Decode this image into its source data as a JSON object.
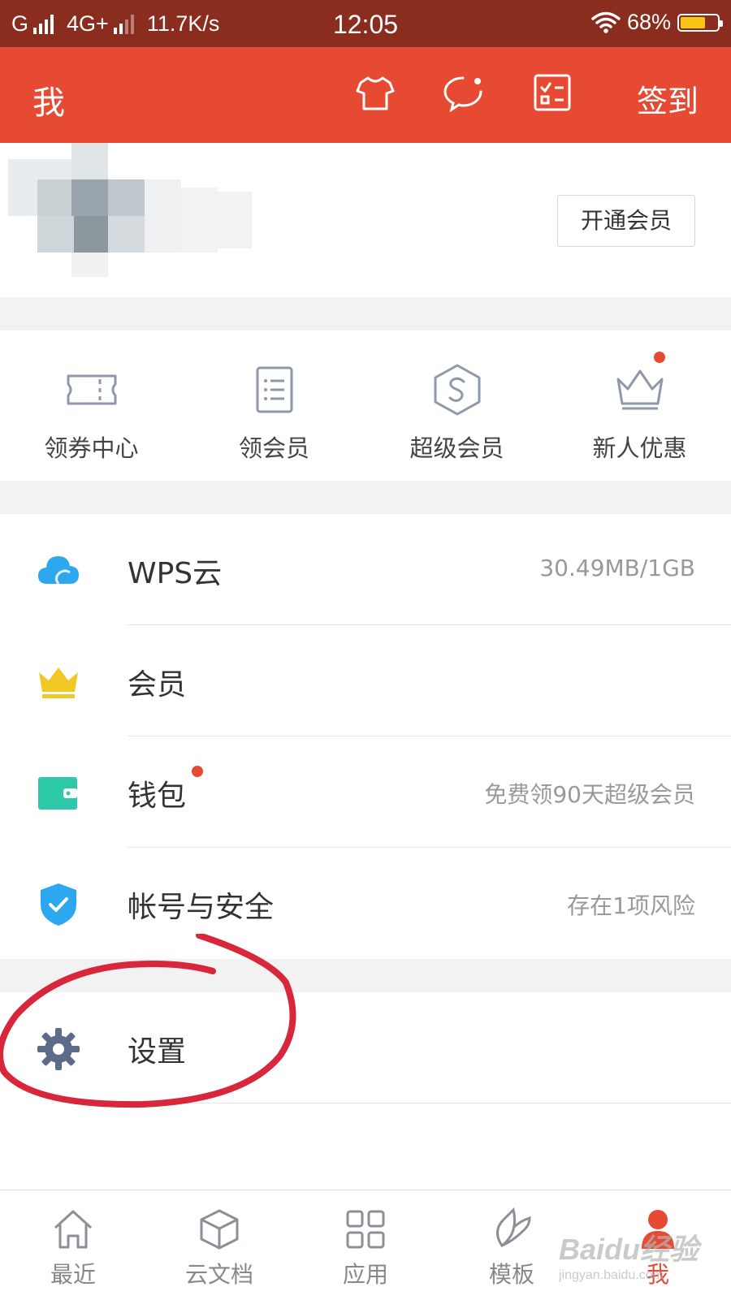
{
  "status_bar": {
    "carrier1": "G",
    "network": "4G+",
    "speed": "11.7K/s",
    "time": "12:05",
    "battery": "68%",
    "battery_level": 0.68
  },
  "header": {
    "title": "我",
    "icons": [
      "tshirt-icon",
      "chat-icon",
      "checklist-icon"
    ],
    "checkin_label": "签到"
  },
  "profile": {
    "member_button": "开通会员"
  },
  "quick_actions": [
    {
      "icon": "ticket-icon",
      "label": "领券中心"
    },
    {
      "icon": "list-icon",
      "label": "领会员"
    },
    {
      "icon": "super-member-icon",
      "label": "超级会员"
    },
    {
      "icon": "crown-outline-icon",
      "label": "新人优惠",
      "badge": true
    }
  ],
  "menu": {
    "wps_cloud": {
      "label": "WPS云",
      "value": "30.49MB/1GB",
      "icon": "cloud-icon",
      "color": "#2da8f0"
    },
    "member": {
      "label": "会员",
      "icon": "crown-icon",
      "color": "#f2c824"
    },
    "wallet": {
      "label": "钱包",
      "value": "免费领90天超级会员",
      "icon": "wallet-icon",
      "color": "#2ec9a8",
      "badge": true
    },
    "security": {
      "label": "帐号与安全",
      "value": "存在1项风险",
      "icon": "shield-icon",
      "color": "#2da8f0"
    },
    "settings": {
      "label": "设置",
      "icon": "gear-icon",
      "color": "#5c6b87"
    }
  },
  "bottom_nav": [
    {
      "label": "最近",
      "icon": "home-icon"
    },
    {
      "label": "云文档",
      "icon": "cube-icon"
    },
    {
      "label": "应用",
      "icon": "grid-icon"
    },
    {
      "label": "模板",
      "icon": "leaf-icon"
    },
    {
      "label": "我",
      "icon": "person-icon",
      "active": true
    }
  ],
  "watermark": {
    "brand": "Baidu经验",
    "url": "jingyan.baidu.com"
  },
  "colors": {
    "status_bar": "#8a2d1e",
    "accent": "#e64a33",
    "annotation": "#d8263b"
  }
}
